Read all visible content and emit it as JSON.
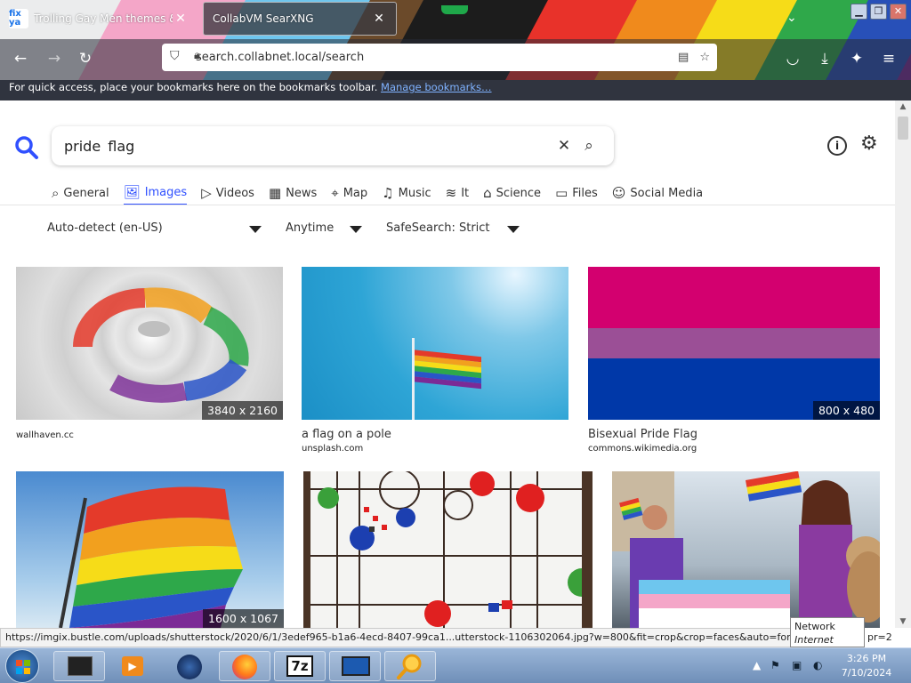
{
  "browser": {
    "tabs": [
      {
        "title": "Trolling Gay Men themes & in"
      },
      {
        "title": "CollabVM SearXNG"
      }
    ],
    "url": "search.collabnet.local/search",
    "bookmarks_message": "For quick access, place your bookmarks here on the bookmarks toolbar.",
    "bookmarks_link": "Manage bookmarks…",
    "favicon_text": "fix ya"
  },
  "search": {
    "query": "pride  flag",
    "categories": [
      {
        "label": "General",
        "icon": "search-icon"
      },
      {
        "label": "Images",
        "icon": "image-icon",
        "active": true
      },
      {
        "label": "Videos",
        "icon": "play-icon"
      },
      {
        "label": "News",
        "icon": "newspaper-icon"
      },
      {
        "label": "Map",
        "icon": "pin-icon"
      },
      {
        "label": "Music",
        "icon": "music-icon"
      },
      {
        "label": "It",
        "icon": "layers-icon"
      },
      {
        "label": "Science",
        "icon": "school-icon"
      },
      {
        "label": "Files",
        "icon": "files-icon"
      },
      {
        "label": "Social Media",
        "icon": "people-icon"
      }
    ],
    "filters": {
      "language": "Auto-detect (en-US)",
      "time": "Anytime",
      "safesearch": "SafeSearch: Strict"
    },
    "accent_color": "#3050ff"
  },
  "results": [
    {
      "resolution": "3840 x 2160",
      "title": "",
      "source": "wallhaven.cc"
    },
    {
      "resolution": "",
      "title": "a flag on a pole",
      "source": "unsplash.com"
    },
    {
      "resolution": "800 x 480",
      "title": "Bisexual Pride Flag",
      "source": "commons.wikimedia.org"
    },
    {
      "resolution": "1600 x 1067",
      "title": "",
      "source": ""
    },
    {
      "resolution": "",
      "title": "",
      "source": ""
    },
    {
      "resolution": "",
      "title": "",
      "source": ""
    }
  ],
  "status_url": "https://imgix.bustle.com/uploads/shutterstock/2020/6/1/3edef965-b1a6-4ecd-8407-99ca1...utterstock-1106302064.jpg?w=800&fit=crop&crop=faces&auto=format,com",
  "status_url_tail": "pr=2",
  "tooltip": {
    "title": "Network",
    "body": "Internet access"
  },
  "taskbar": {
    "time": "3:26 PM",
    "date": "7/10/2024",
    "app_7z": "7z"
  }
}
